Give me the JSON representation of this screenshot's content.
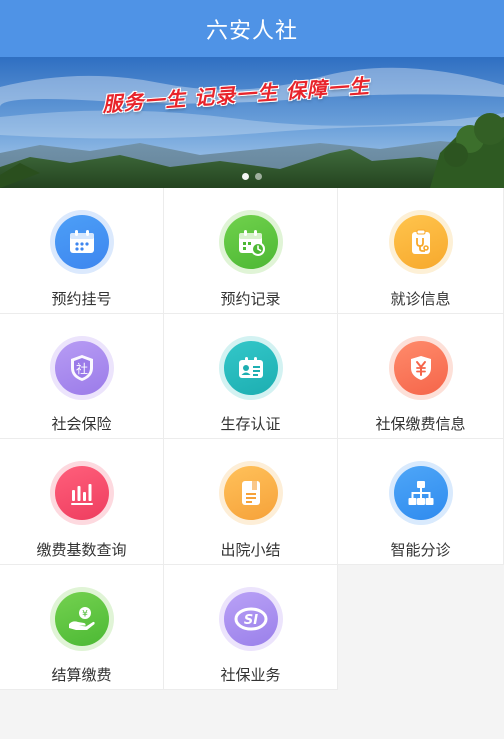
{
  "header": {
    "title": "六安人社"
  },
  "banner": {
    "slogan": "服务一生  记录一生  保障一生",
    "slogan_color": "#e8242b",
    "dots": 2,
    "active_dot": 0
  },
  "colors": {
    "header_bg": "#4f93e6",
    "page_bg": "#f4f4f4",
    "label_text": "#333333"
  },
  "menu": [
    {
      "label": "预约挂号",
      "icon": "calendar-icon",
      "color_a": "#4c9ff7",
      "color_b": "#3e86ef",
      "ring": "#dbe9fd"
    },
    {
      "label": "预约记录",
      "icon": "calendar-clock-icon",
      "color_a": "#70d14c",
      "color_b": "#4db834",
      "ring": "#e0f4d6"
    },
    {
      "label": "就诊信息",
      "icon": "clipboard-stethoscope-icon",
      "color_a": "#ffc44d",
      "color_b": "#f7a92d",
      "ring": "#fdf0d6"
    },
    {
      "label": "社会保险",
      "icon": "shield-social-icon",
      "color_a": "#b79cf4",
      "color_b": "#9b7be9",
      "ring": "#ece4fc"
    },
    {
      "label": "生存认证",
      "icon": "id-card-icon",
      "color_a": "#33c7c9",
      "color_b": "#1daeb1",
      "ring": "#d3f2f2"
    },
    {
      "label": "社保缴费信息",
      "icon": "yen-shield-icon",
      "color_a": "#ff8b6b",
      "color_b": "#f5654a",
      "ring": "#fde0d8"
    },
    {
      "label": "缴费基数查询",
      "icon": "bar-chart-icon",
      "color_a": "#ff5f7b",
      "color_b": "#ee3d5f",
      "ring": "#fdd9df"
    },
    {
      "label": "出院小结",
      "icon": "document-icon",
      "color_a": "#ffc15a",
      "color_b": "#f6a23a",
      "ring": "#fdeed7"
    },
    {
      "label": "智能分诊",
      "icon": "hierarchy-icon",
      "color_a": "#4ea6f7",
      "color_b": "#2f8bef",
      "ring": "#d9eafd"
    },
    {
      "label": "结算缴费",
      "icon": "hand-coin-icon",
      "color_a": "#74d150",
      "color_b": "#4cb934",
      "ring": "#e0f4d6"
    },
    {
      "label": "社保业务",
      "icon": "si-logo-icon",
      "color_a": "#b9a1f6",
      "color_b": "#9a80ea",
      "ring": "#ece4fc"
    }
  ]
}
